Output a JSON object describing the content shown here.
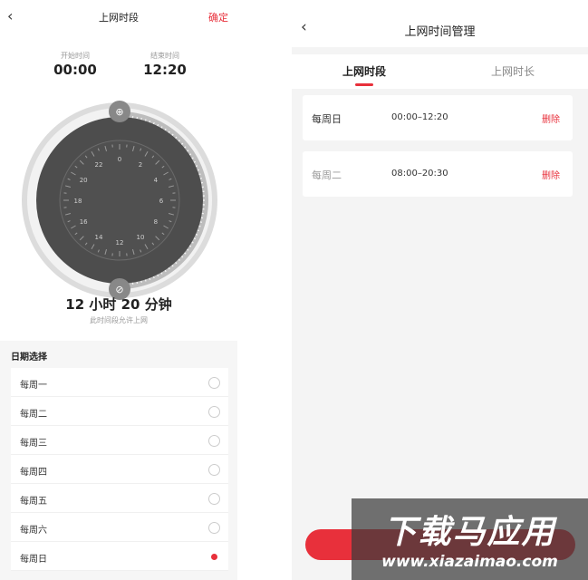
{
  "left": {
    "header": {
      "back_icon": "chevron-left-icon",
      "title": "上网时段",
      "confirm_label": "确定"
    },
    "start": {
      "label": "开始时间",
      "value": "00:00"
    },
    "end": {
      "label": "结束时间",
      "value": "12:20"
    },
    "dial_numbers": [
      "0",
      "2",
      "4",
      "6",
      "8",
      "10",
      "12",
      "14",
      "16",
      "18",
      "20",
      "22"
    ],
    "duration": "12 小时 20 分钟",
    "duration_note": "此时间段允许上网",
    "date_heading": "日期选择",
    "days": [
      {
        "label": "每周一",
        "selected": false
      },
      {
        "label": "每周二",
        "selected": false
      },
      {
        "label": "每周三",
        "selected": false
      },
      {
        "label": "每周四",
        "selected": false
      },
      {
        "label": "每周五",
        "selected": false
      },
      {
        "label": "每周六",
        "selected": false
      },
      {
        "label": "每周日",
        "selected": true
      }
    ]
  },
  "right": {
    "header": {
      "back_icon": "chevron-left-icon",
      "title": "上网时间管理"
    },
    "tabs": [
      {
        "label": "上网时段",
        "active": true
      },
      {
        "label": "上网时长",
        "active": false
      }
    ],
    "entries": [
      {
        "day": "每周日",
        "time": "00:00–12:20",
        "delete_label": "删除"
      },
      {
        "day": "每周二",
        "time": "08:00–20:30",
        "delete_label": "删除"
      }
    ]
  },
  "watermark": {
    "title": "下载马应用",
    "url": "www.xiazaimao.com"
  },
  "colors": {
    "accent": "#e8303b",
    "dial_dark": "#4a4a4a",
    "dial_track": "#d8d8d8"
  }
}
